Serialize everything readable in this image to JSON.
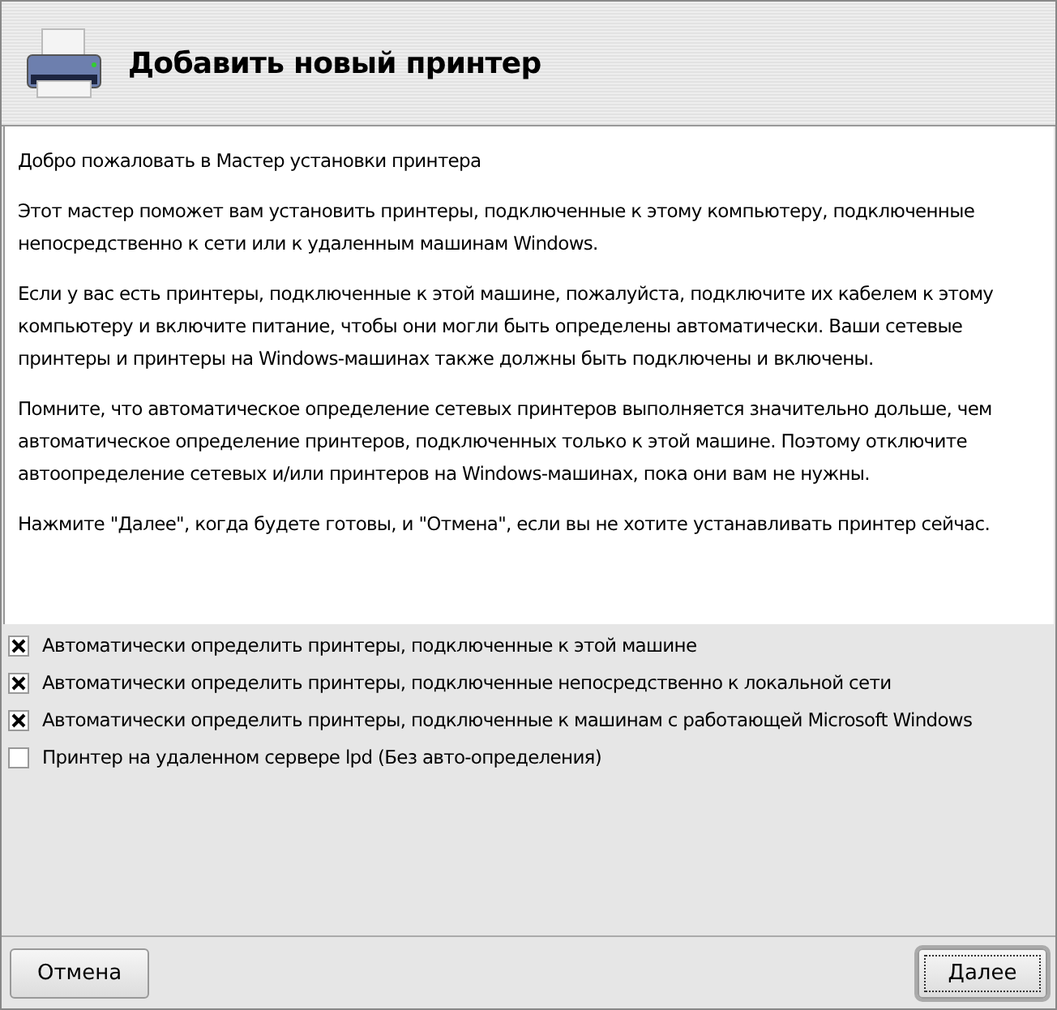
{
  "header": {
    "title": "Добавить новый принтер"
  },
  "intro": [
    "Добро пожаловать в Мастер установки принтера",
    "Этот мастер поможет вам установить принтеры, подключенные к этому компьютеру, подключенные непосредственно к сети или к удаленным машинам Windows.",
    "Если у вас есть принтеры, подключенные к этой машине, пожалуйста, подключите их кабелем к этому компьютеру и включите питание, чтобы они могли быть определены автоматически. Ваши сетевые принтеры и принтеры на Windows-машинах также должны быть подключены и включены.",
    "Помните, что автоматическое определение сетевых принтеров выполняется значительно дольше, чем автоматическое определение принтеров, подключенных только к этой машине. Поэтому отключите автоопределение сетевых и/или принтеров на Windows-машинах, пока они вам не нужны.",
    "Нажмите \"Далее\", когда будете готовы, и \"Отмена\", если вы не хотите устанавливать принтер сейчас."
  ],
  "options": [
    {
      "label": "Автоматически определить принтеры, подключенные к этой машине",
      "checked": true
    },
    {
      "label": "Автоматически определить принтеры, подключенные непосредственно к локальной сети",
      "checked": true
    },
    {
      "label": "Автоматически определить принтеры, подключенные к машинам с работающей Microsoft Windows",
      "checked": true
    },
    {
      "label": "Принтер на удаленном сервере lpd (Без авто-определения)",
      "checked": false
    }
  ],
  "buttons": [
    {
      "label": "Отмена",
      "default": false
    },
    {
      "label": "Далее",
      "default": true
    }
  ]
}
